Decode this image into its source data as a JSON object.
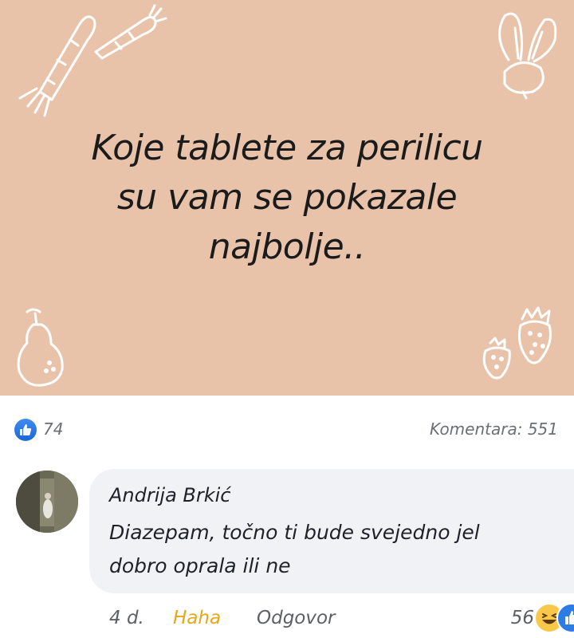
{
  "post": {
    "headline_line1": "Koje tablete za perilicu",
    "headline_line2": "su vam se pokazale",
    "headline_line3": "najbolje..",
    "background_color": "#e8c3aa"
  },
  "stats": {
    "likes": "74",
    "comments": "Komentara: 551"
  },
  "comment": {
    "author": "Andrija Brkić",
    "text": "Diazepam, točno ti bude svejedno jel dobro oprala ili ne",
    "time": "4 d.",
    "reaction_label": "Haha",
    "reply_label": "Odgovor",
    "reaction_count": "56"
  },
  "icons": {
    "like": "thumbs-up-icon",
    "haha": "laughing-face-icon"
  },
  "colors": {
    "haha": "#e6a817",
    "meta": "#5c5f63",
    "like_blue": "#1b67d6"
  }
}
